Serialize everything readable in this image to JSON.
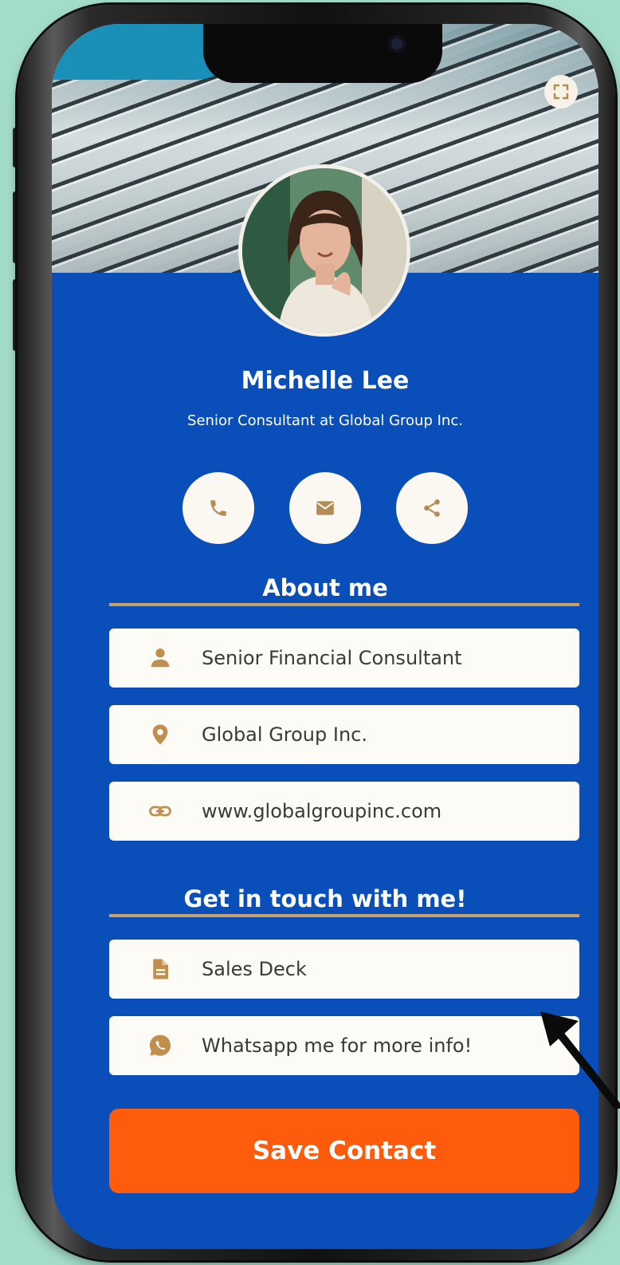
{
  "profile": {
    "name": "Michelle Lee",
    "subtitle": "Senior Consultant at Global Group Inc."
  },
  "actions": [
    {
      "icon": "phone-icon"
    },
    {
      "icon": "mail-icon"
    },
    {
      "icon": "share-icon"
    }
  ],
  "about": {
    "title": "About me",
    "items": [
      {
        "icon": "person-icon",
        "text": "Senior Financial Consultant"
      },
      {
        "icon": "location-pin-icon",
        "text": "Global Group Inc."
      },
      {
        "icon": "link-icon",
        "text": "www.globalgroupinc.com"
      }
    ]
  },
  "contact": {
    "title": "Get in touch with me!",
    "items": [
      {
        "icon": "document-icon",
        "text": "Sales Deck"
      },
      {
        "icon": "whatsapp-icon",
        "text": "Whatsapp me for more info!"
      }
    ]
  },
  "save_button": {
    "label": "Save Contact"
  },
  "colors": {
    "background": "#a4dccb",
    "card_blue": "#0a4fb9",
    "accent_gold": "#c7a16a",
    "save_orange": "#ff5b0c"
  }
}
